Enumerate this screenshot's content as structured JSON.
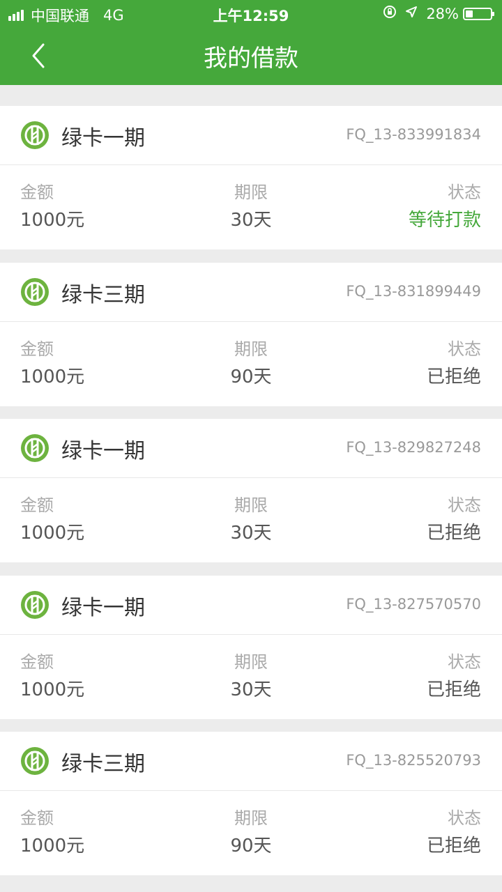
{
  "status_bar": {
    "carrier": "中国联通",
    "network": "4G",
    "time": "上午12:59",
    "battery": "28%"
  },
  "header": {
    "title": "我的借款"
  },
  "labels": {
    "amount": "金额",
    "term": "期限",
    "status": "状态"
  },
  "colors": {
    "brand_green": "#45a83b",
    "status_pending": "#45a83b"
  },
  "loans": [
    {
      "product": "绿卡一期",
      "order_no": "FQ_13-833991834",
      "amount": "1000元",
      "term": "30天",
      "status": "等待打款"
    },
    {
      "product": "绿卡三期",
      "order_no": "FQ_13-831899449",
      "amount": "1000元",
      "term": "90天",
      "status": "已拒绝"
    },
    {
      "product": "绿卡一期",
      "order_no": "FQ_13-829827248",
      "amount": "1000元",
      "term": "30天",
      "status": "已拒绝"
    },
    {
      "product": "绿卡一期",
      "order_no": "FQ_13-827570570",
      "amount": "1000元",
      "term": "30天",
      "status": "已拒绝"
    },
    {
      "product": "绿卡三期",
      "order_no": "FQ_13-825520793",
      "amount": "1000元",
      "term": "90天",
      "status": "已拒绝"
    }
  ]
}
